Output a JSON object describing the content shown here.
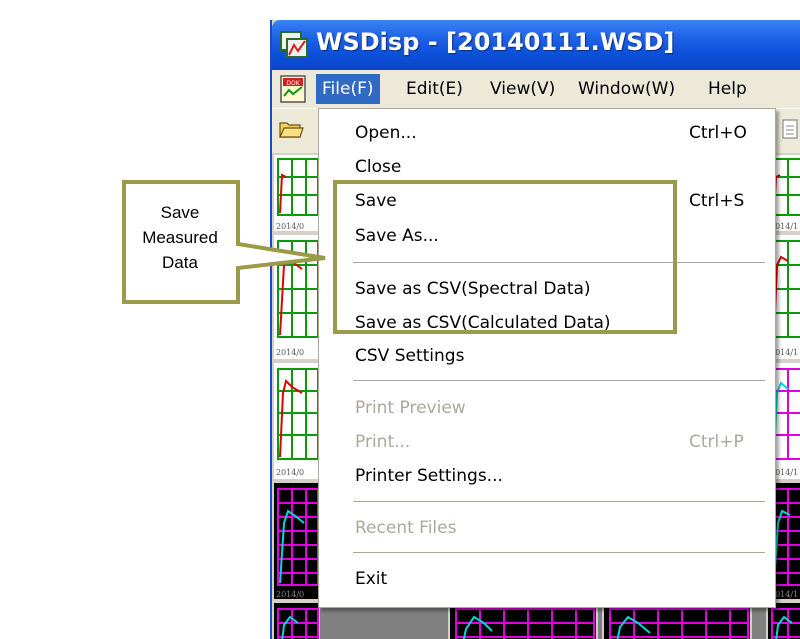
{
  "window": {
    "title": "WSDisp - [20140111.WSD]",
    "app_icon": "app-window-icon",
    "doc_icon": "document-icon"
  },
  "menubar": {
    "items": [
      {
        "label": "File(F)",
        "active": true
      },
      {
        "label": "Edit(E)",
        "active": false
      },
      {
        "label": "View(V)",
        "active": false
      },
      {
        "label": "Window(W)",
        "active": false
      },
      {
        "label": "Help",
        "active": false
      }
    ]
  },
  "toolbar": {
    "icons": [
      "open-folder-icon",
      "document-icon"
    ]
  },
  "file_menu": {
    "items": [
      {
        "label": "Open...",
        "shortcut": "Ctrl+O",
        "enabled": true
      },
      {
        "label": "Close",
        "shortcut": "",
        "enabled": true
      },
      {
        "label": "Save",
        "shortcut": "Ctrl+S",
        "enabled": true
      },
      {
        "label": "Save As...",
        "shortcut": "",
        "enabled": true
      },
      {
        "label": "Save as CSV(Spectral Data)",
        "shortcut": "",
        "enabled": true
      },
      {
        "label": "Save as CSV(Calculated Data)",
        "shortcut": "",
        "enabled": true
      },
      {
        "label": "CSV Settings",
        "shortcut": "",
        "enabled": true
      },
      {
        "label": "Print Preview",
        "shortcut": "",
        "enabled": false
      },
      {
        "label": "Print...",
        "shortcut": "Ctrl+P",
        "enabled": false
      },
      {
        "label": "Printer Settings...",
        "shortcut": "",
        "enabled": true
      },
      {
        "label": "Recent Files",
        "shortcut": "",
        "enabled": false
      },
      {
        "label": "Exit",
        "shortcut": "",
        "enabled": true
      }
    ]
  },
  "annotation": {
    "callout_text": "Save Measured Data",
    "box_color": "#9a9a48",
    "callout_fill": "#ffffff"
  },
  "thumbnails": {
    "date_label": "2014/0",
    "date_label_right": "2014/1",
    "green_color": "#0a9a0a",
    "magenta_color": "#e000e0",
    "red_color": "#e00000",
    "cyan_color": "#00d8d8"
  }
}
